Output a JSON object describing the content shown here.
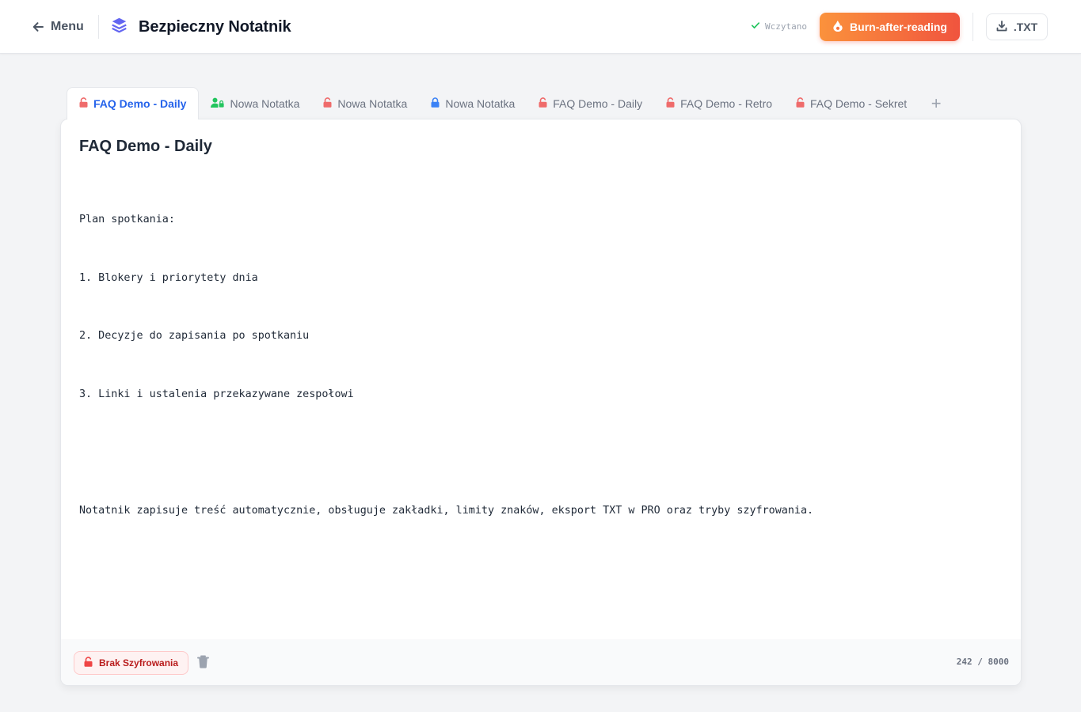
{
  "header": {
    "menu_label": "Menu",
    "app_title": "Bezpieczny Notatnik",
    "status_text": "Wczytano",
    "burn_label": "Burn-after-reading",
    "export_label": ".TXT"
  },
  "tabs": [
    {
      "label": "FAQ Demo - Daily",
      "icon": "lock-open-icon",
      "icon_color": "#ef6b6b",
      "active": true
    },
    {
      "label": "Nowa Notatka",
      "icon": "user-lock-icon",
      "icon_color": "#22c55e",
      "active": false
    },
    {
      "label": "Nowa Notatka",
      "icon": "lock-open-icon",
      "icon_color": "#ef6b6b",
      "active": false
    },
    {
      "label": "Nowa Notatka",
      "icon": "lock-icon",
      "icon_color": "#3b82f6",
      "active": false
    },
    {
      "label": "FAQ Demo - Daily",
      "icon": "lock-open-icon",
      "icon_color": "#ef6b6b",
      "active": false
    },
    {
      "label": "FAQ Demo - Retro",
      "icon": "lock-open-icon",
      "icon_color": "#ef6b6b",
      "active": false
    },
    {
      "label": "FAQ Demo - Sekret",
      "icon": "lock-open-icon",
      "icon_color": "#ef6b6b",
      "active": false
    }
  ],
  "add_tab_label": "+",
  "note": {
    "title": "FAQ Demo - Daily",
    "lines": [
      "Plan spotkania:",
      "1. Blokery i priorytety dnia",
      "2. Decyzje do zapisania po spotkaniu",
      "3. Linki i ustalenia przekazywane zespołowi",
      "",
      "Notatnik zapisuje treść automatycznie, obsługuje zakładki, limity znaków, eksport TXT w PRO oraz tryby szyfrowania."
    ]
  },
  "footer": {
    "encryption_label": "Brak Szyfrowania",
    "char_counter": "242 / 8000"
  },
  "colors": {
    "accent_blue": "#2563eb",
    "brand_indigo": "#6366f1",
    "burn_gradient_start": "#fb923c",
    "burn_gradient_end": "#f0543e",
    "status_green": "#22c55e",
    "warning_red": "#ef4444"
  }
}
